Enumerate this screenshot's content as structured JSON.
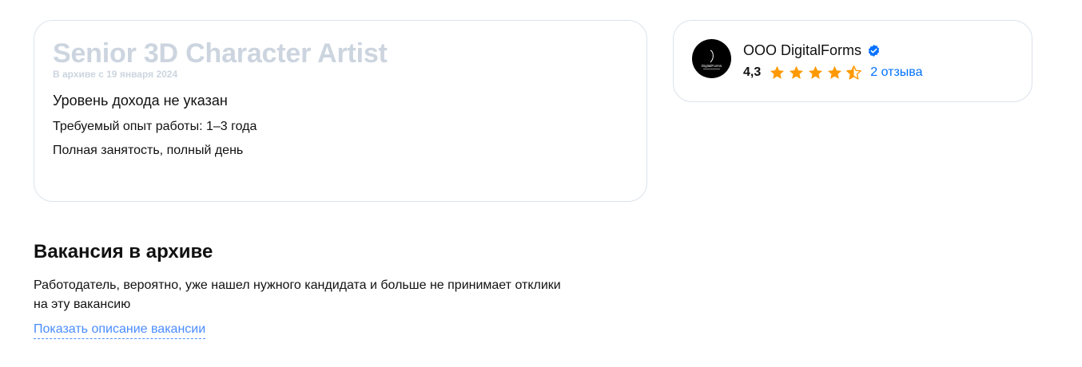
{
  "vacancy": {
    "title": "Senior 3D Character Artist",
    "archived_since": "В архиве с 19 января 2024",
    "salary": "Уровень дохода не указан",
    "experience": "Требуемый опыт работы: 1–3 года",
    "employment": "Полная занятость, полный день"
  },
  "company": {
    "name": "ООО DigitalForms",
    "logo_text": "DigitalForms",
    "rating": "4,3",
    "rating_value": 4.3,
    "rating_max": 5,
    "reviews_label": "2 отзыва",
    "verified_icon": "verified-check-icon",
    "star_color": "#ff9900",
    "verified_color": "#0070ff"
  },
  "archive": {
    "heading": "Вакансия в архиве",
    "text_line1": "Работодатель, вероятно, уже нашел нужного кандидата и больше не принимает отклики",
    "text_line2": "на эту вакансию",
    "show_description_label": "Показать описание вакансии"
  }
}
